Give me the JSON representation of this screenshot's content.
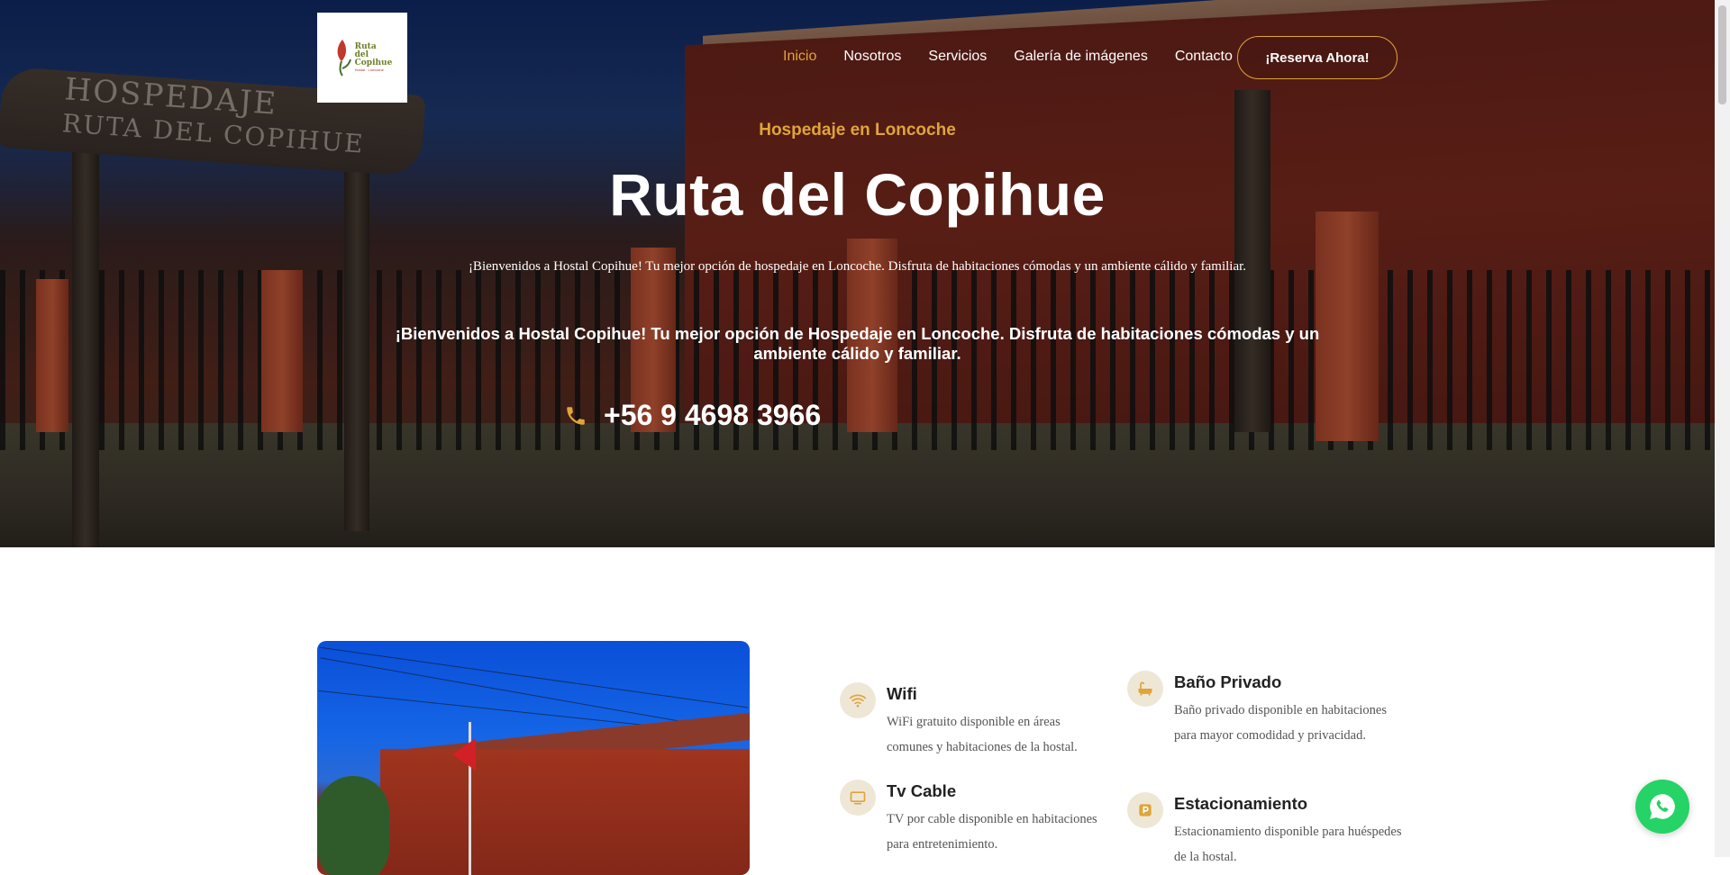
{
  "brand": {
    "logo_line1": "Ruta",
    "logo_line2": "del",
    "logo_line3": "Copihue",
    "logo_sub": "Hostal · Loncoche"
  },
  "nav": {
    "items": [
      {
        "label": "Inicio",
        "active": true
      },
      {
        "label": "Nosotros"
      },
      {
        "label": "Servicios"
      },
      {
        "label": "Galería de imágenes"
      },
      {
        "label": "Contacto"
      }
    ],
    "cta_label": "¡Reserva Ahora!"
  },
  "hero": {
    "tagline": "Hospedaje en Loncoche",
    "title": "Ruta del Copihue",
    "description_small": "¡Bienvenidos a Hostal Copihue! Tu mejor opción de hospedaje en Loncoche. Disfruta de habitaciones cómodas y un ambiente cálido y familiar.",
    "description_large": "¡Bienvenidos a Hostal Copihue! Tu mejor opción de Hospedaje en Loncoche. Disfruta de habitaciones cómodas y un ambiente cálido y familiar.",
    "phone": "+56 9 4698 3966",
    "sign_text": [
      "HOSPEDAJE",
      "RUTA DEL COPIHUE"
    ]
  },
  "features": [
    {
      "icon": "wifi-icon",
      "title": "Wifi",
      "description": "WiFi gratuito disponible en áreas comunes y habitaciones de la hostal."
    },
    {
      "icon": "tv-icon",
      "title": "Tv Cable",
      "description": "TV por cable disponible en habitaciones para entretenimiento."
    },
    {
      "icon": "bathtub-icon",
      "title": "Baño Privado",
      "description": "Baño privado disponible en habitaciones para mayor comodidad y privacidad."
    },
    {
      "icon": "parking-icon",
      "title": "Estacionamiento",
      "description": "Estacionamiento disponible para huéspedes de la hostal."
    }
  ],
  "colors": {
    "accent": "#e0a43a",
    "icon_bg": "#efe7d6",
    "whatsapp": "#25d366"
  }
}
